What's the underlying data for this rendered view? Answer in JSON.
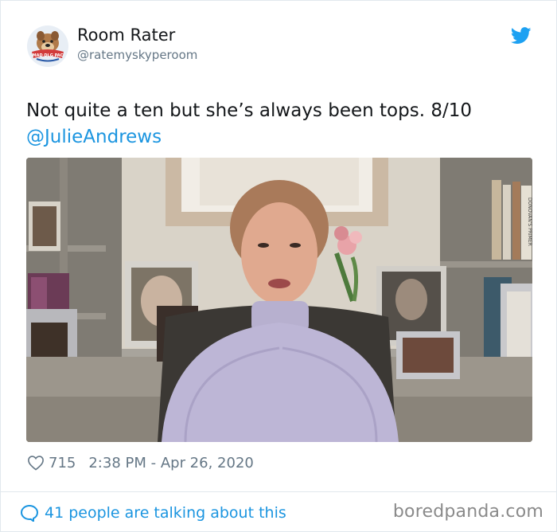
{
  "tweet": {
    "author_name": "Room Rater",
    "author_handle": "@ratemyskyperoom",
    "avatar_badge_text": "MAD DLG PAC",
    "text": "Not quite a ten but she’s always been tops. 8/10",
    "mention": "@JulieAndrews",
    "likes": "715",
    "timestamp": "2:38 PM - Apr 26, 2020",
    "conversation_link": "41 people are talking about this"
  },
  "media": {
    "book_spine_text": "DONOVAN'S PRIMER"
  },
  "watermark": "boredpanda.com",
  "colors": {
    "link": "#1b95e0",
    "secondary_text": "#657786",
    "border": "#e1e8ed"
  },
  "icons": [
    "avatar-logo",
    "twitter-bird-icon",
    "heart-icon",
    "speech-bubble-icon"
  ]
}
